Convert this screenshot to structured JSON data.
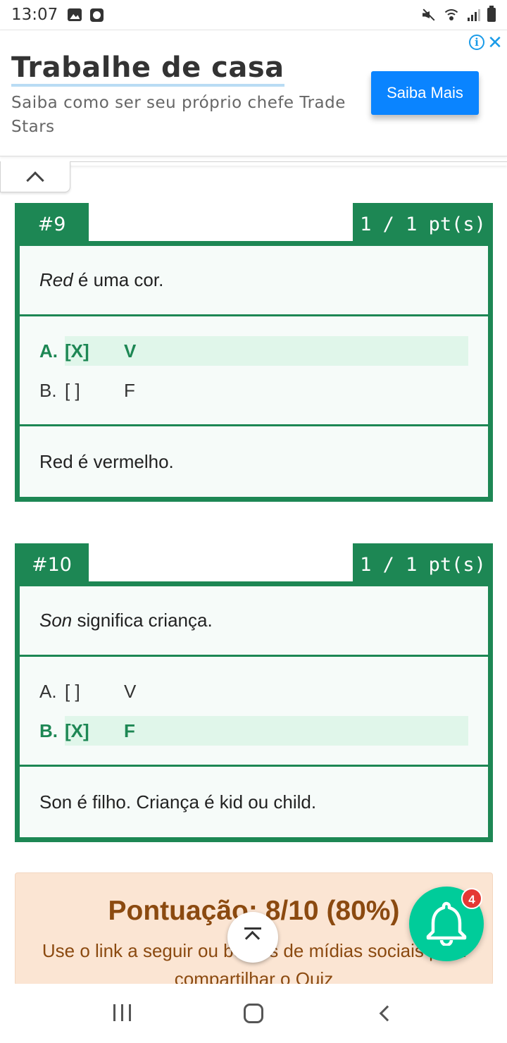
{
  "status_bar": {
    "time": "13:07"
  },
  "ad": {
    "title": "Trabalhe de casa",
    "subtitle": "Saiba como ser seu próprio chefe Trade Stars",
    "button_label": "Saiba Mais",
    "info_icon": "info-icon",
    "close_glyph": "✕"
  },
  "questions": [
    {
      "number": "#9",
      "points": "1 / 1 pt(s)",
      "text_em": "Red",
      "text_rest": " é uma cor.",
      "options": [
        {
          "label": "A.",
          "mark": "[X]",
          "value": "V",
          "selected": true
        },
        {
          "label": "B.",
          "mark": "[ ]",
          "value": "F",
          "selected": false
        }
      ],
      "explanation": "Red é vermelho."
    },
    {
      "number": "#10",
      "points": "1 / 1 pt(s)",
      "text_em": "Son",
      "text_rest": " significa criança.",
      "options": [
        {
          "label": "A.",
          "mark": "[ ]",
          "value": "V",
          "selected": false
        },
        {
          "label": "B.",
          "mark": "[X]",
          "value": "F",
          "selected": true
        }
      ],
      "explanation": "Son é filho. Criança é kid ou child."
    }
  ],
  "score": {
    "title": "Pontuação: 8/10 (80%)",
    "text": "Use o link a seguir ou botões de mídias sociais para compartilhar o Quiz"
  },
  "notifications": {
    "badge_count": "4"
  },
  "colors": {
    "accent_green": "#1d8754",
    "selected_bg": "#e0f6ea",
    "ad_button": "#0a84ff",
    "bell_button": "#00cc9a",
    "badge": "#e53935",
    "score_bg": "#fbe5d3",
    "score_text": "#8b4a10"
  }
}
